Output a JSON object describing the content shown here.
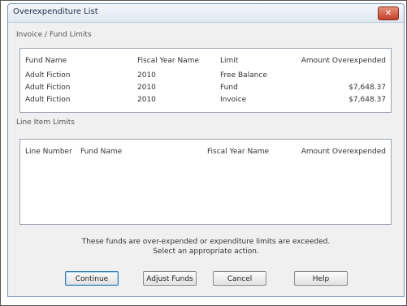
{
  "window": {
    "title": "Overexpenditure List"
  },
  "invoice_section": {
    "label": "Invoice / Fund Limits",
    "columns": [
      "Fund Name",
      "Fiscal Year Name",
      "Limit",
      "Amount Overexpended"
    ],
    "rows": [
      [
        "Adult Fiction",
        "2010",
        "Free Balance",
        ""
      ],
      [
        "Adult Fiction",
        "2010",
        "Fund",
        "$7,648.37"
      ],
      [
        "Adult Fiction",
        "2010",
        "Invoice",
        "$7,648.37"
      ]
    ]
  },
  "line_item_section": {
    "label": "Line Item Limits",
    "columns": [
      "Line Number",
      "Fund Name",
      "Fiscal Year Name",
      "Amount Overexpended"
    ],
    "rows": []
  },
  "message": {
    "line1": "These funds are over-expended or expenditure limits are exceeded.",
    "line2": "Select an appropriate action."
  },
  "buttons": {
    "continue": "Continue",
    "adjust": "Adjust Funds",
    "cancel": "Cancel",
    "help": "Help"
  },
  "icons": {
    "close": "close-icon"
  },
  "colors": {
    "close_button": "#c2412a",
    "title_bg": "#dfe8f2",
    "default_button_border": "#3c7fb1"
  }
}
